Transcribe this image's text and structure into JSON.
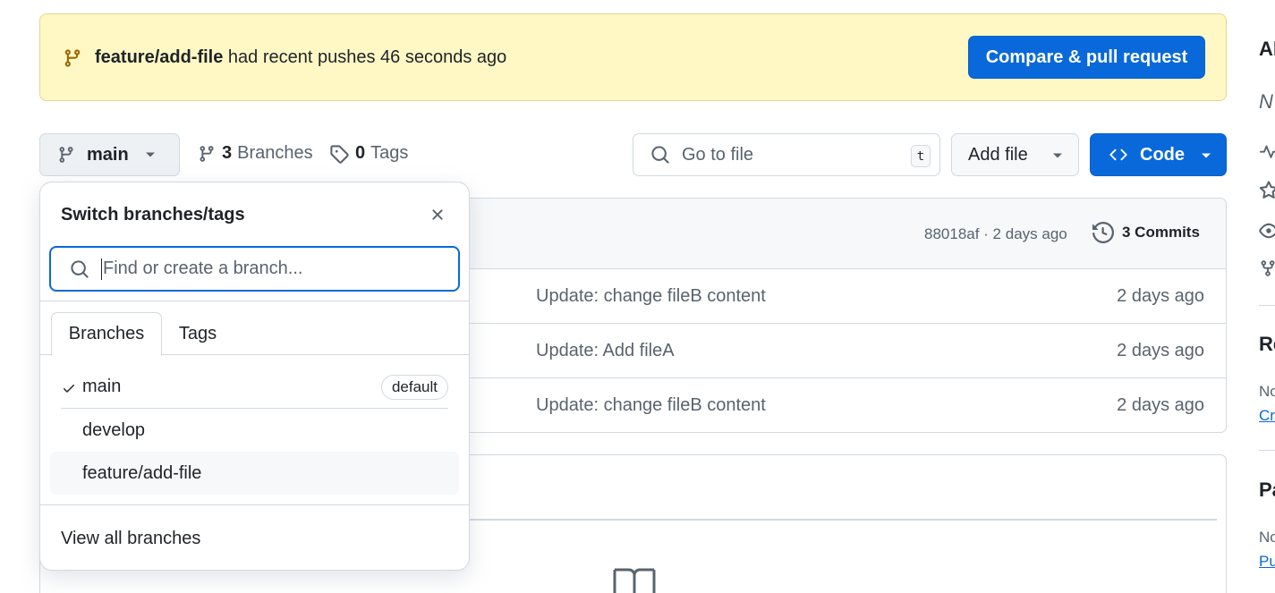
{
  "banner": {
    "branch": "feature/add-file",
    "text": " had recent pushes 46 seconds ago",
    "cta": "Compare & pull request"
  },
  "toolbar": {
    "current_branch": "main",
    "branches_count": "3",
    "branches_label": "Branches",
    "tags_count": "0",
    "tags_label": "Tags",
    "goto_placeholder": "Go to file",
    "goto_shortcut": "t",
    "add_file": "Add file",
    "code": "Code"
  },
  "files": {
    "commit_sha": "88018af · 2 days ago",
    "commits_label": "3 Commits",
    "rows": [
      {
        "message": "Update: change fileB content",
        "age": "2 days ago"
      },
      {
        "message": "Update: Add fileA",
        "age": "2 days ago"
      },
      {
        "message": "Update: change fileB content",
        "age": "2 days ago"
      }
    ]
  },
  "sidebar": {
    "about_heading": "Al",
    "about_desc": "N",
    "releases_heading": "Re",
    "releases_text": "No",
    "releases_link": "Cr",
    "packages_heading": "Pa",
    "packages_text": "No",
    "packages_link": "Pu"
  },
  "dropdown": {
    "title": "Switch branches/tags",
    "search_placeholder": "Find or create a branch...",
    "tabs": [
      "Branches",
      "Tags"
    ],
    "branches": [
      {
        "name": "main",
        "badge": "default"
      },
      {
        "name": "develop"
      },
      {
        "name": "feature/add-file"
      }
    ],
    "view_all": "View all branches"
  }
}
